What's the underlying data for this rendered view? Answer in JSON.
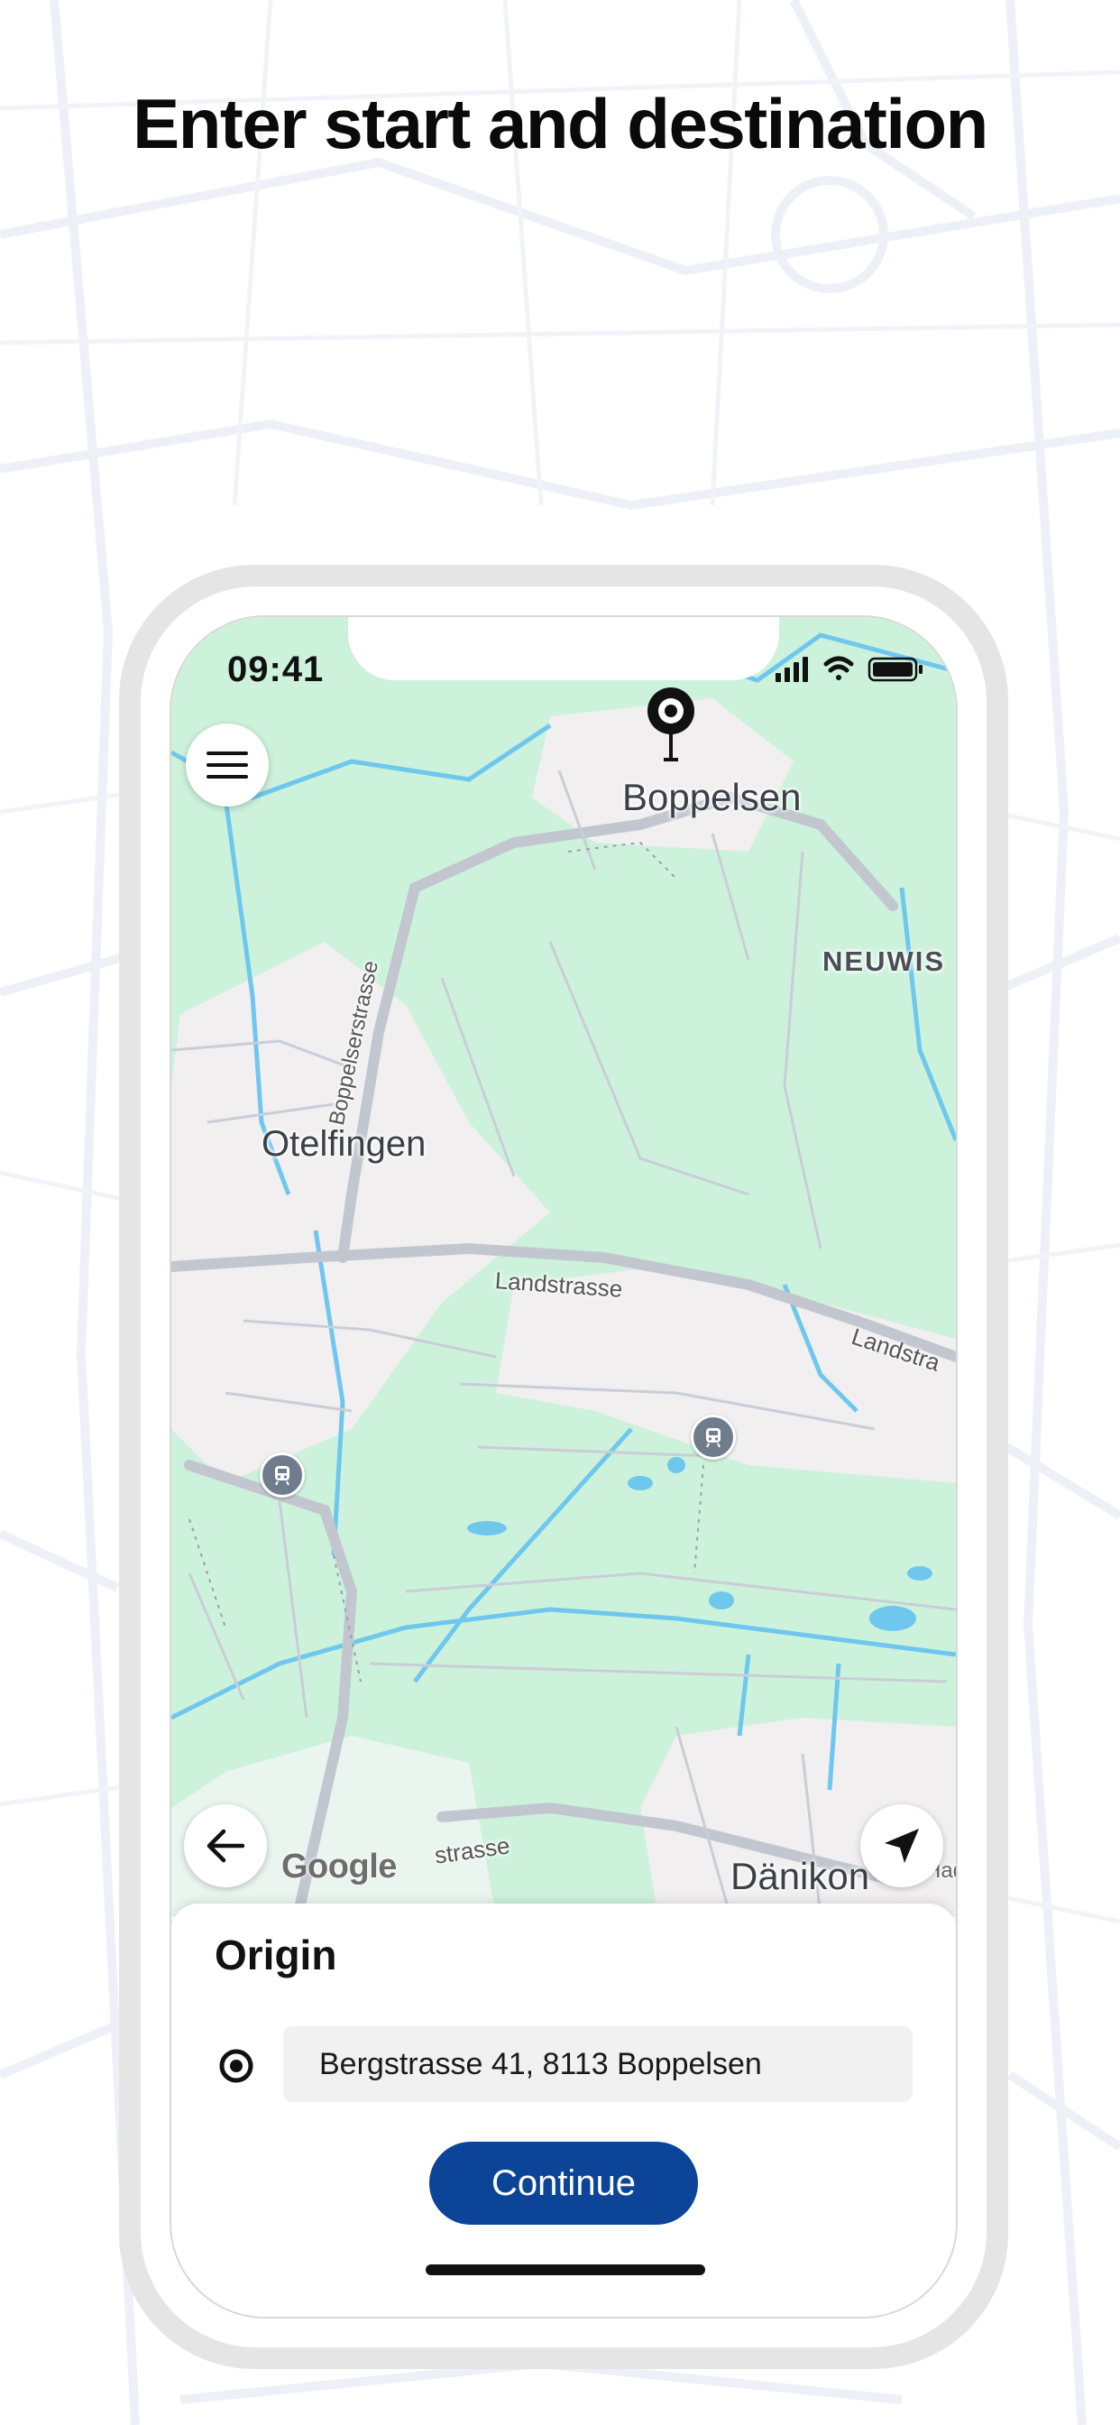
{
  "headline": "Enter start and destination",
  "status_bar": {
    "time": "09:41"
  },
  "map": {
    "labels": {
      "boppelsen": "Boppelsen",
      "neuwis": "NEUWIS",
      "otelfingen": "Otelfingen",
      "danikon": "Dänikon",
      "road_landstrasse_1": "Landstrasse",
      "road_landstrasse_2": "Landstra",
      "road_boppelserstrasse": "Boppelserstrasse",
      "road_strasse": "strasse",
      "faded": "Hadu"
    },
    "attribution": "Google",
    "colors": {
      "land": "#cdf2dc",
      "settlement": "#f1eff0",
      "water": "#6fc7ee",
      "road": "#c4c9d1"
    }
  },
  "sheet": {
    "title": "Origin",
    "origin_value": "Bergstrasse 41, 8113 Boppelsen",
    "continue_label": "Continue"
  },
  "colors": {
    "primary_button": "#0c4597"
  }
}
